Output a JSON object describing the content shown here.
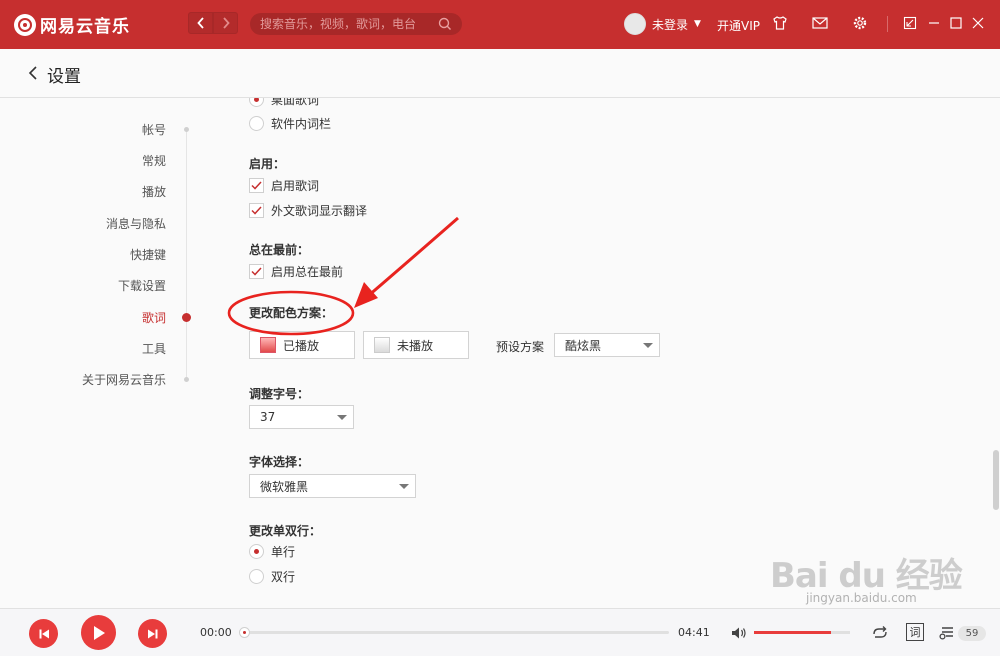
{
  "app": {
    "name": "网易云音乐",
    "logo_glyph": "云"
  },
  "topbar": {
    "back_glyph": "<",
    "forward_glyph": ">",
    "search_placeholder": "搜索音乐，视频，歌词，电台",
    "user_name": "未登录",
    "user_caret": "▼",
    "vip_label": "开通VIP",
    "icons": [
      "skin-icon",
      "mail-icon",
      "settings-icon",
      "mini-mode-icon",
      "minimize-icon",
      "maximize-icon",
      "close-icon"
    ],
    "accent_color": "#c62f2f"
  },
  "page": {
    "title": "设置"
  },
  "settings_nav": {
    "items": [
      {
        "label": "帐号",
        "active": false
      },
      {
        "label": "常规",
        "active": false
      },
      {
        "label": "播放",
        "active": false
      },
      {
        "label": "消息与隐私",
        "active": false
      },
      {
        "label": "快捷键",
        "active": false
      },
      {
        "label": "下载设置",
        "active": false
      },
      {
        "label": "歌词",
        "active": true
      },
      {
        "label": "工具",
        "active": false
      },
      {
        "label": "关于网易云音乐",
        "active": false
      }
    ]
  },
  "lyrics": {
    "display_options": [
      {
        "label": "桌面歌词",
        "checked": true
      },
      {
        "label": "软件内词栏",
        "checked": false
      }
    ],
    "enable_title": "启用：",
    "enable_options": [
      {
        "label": "启用歌词",
        "checked": true
      },
      {
        "label": "外文歌词显示翻译",
        "checked": true
      }
    ],
    "ontop_title": "总在最前：",
    "ontop_options": [
      {
        "label": "启用总在最前",
        "checked": true
      }
    ],
    "color_title": "更改配色方案：",
    "color_played_label": "已播放",
    "color_unplayed_label": "未播放",
    "preset_label": "预设方案",
    "preset_value": "酷炫黑",
    "fontsize_title": "调整字号：",
    "fontsize_value": "37",
    "font_title": "字体选择：",
    "font_value": "微软雅黑",
    "lines_title": "更改单双行：",
    "lines_options": [
      {
        "label": "单行",
        "checked": true
      },
      {
        "label": "双行",
        "checked": false
      }
    ]
  },
  "player": {
    "time_current": "00:00",
    "time_total": "04:41",
    "progress": 0,
    "volume_level": 0.8,
    "lyrics_button": "词",
    "playlist_count": "59",
    "play_color": "#e83c3c"
  },
  "watermark": {
    "logo_text": "Bai du 经验",
    "url": "jingyan.baidu.com"
  }
}
